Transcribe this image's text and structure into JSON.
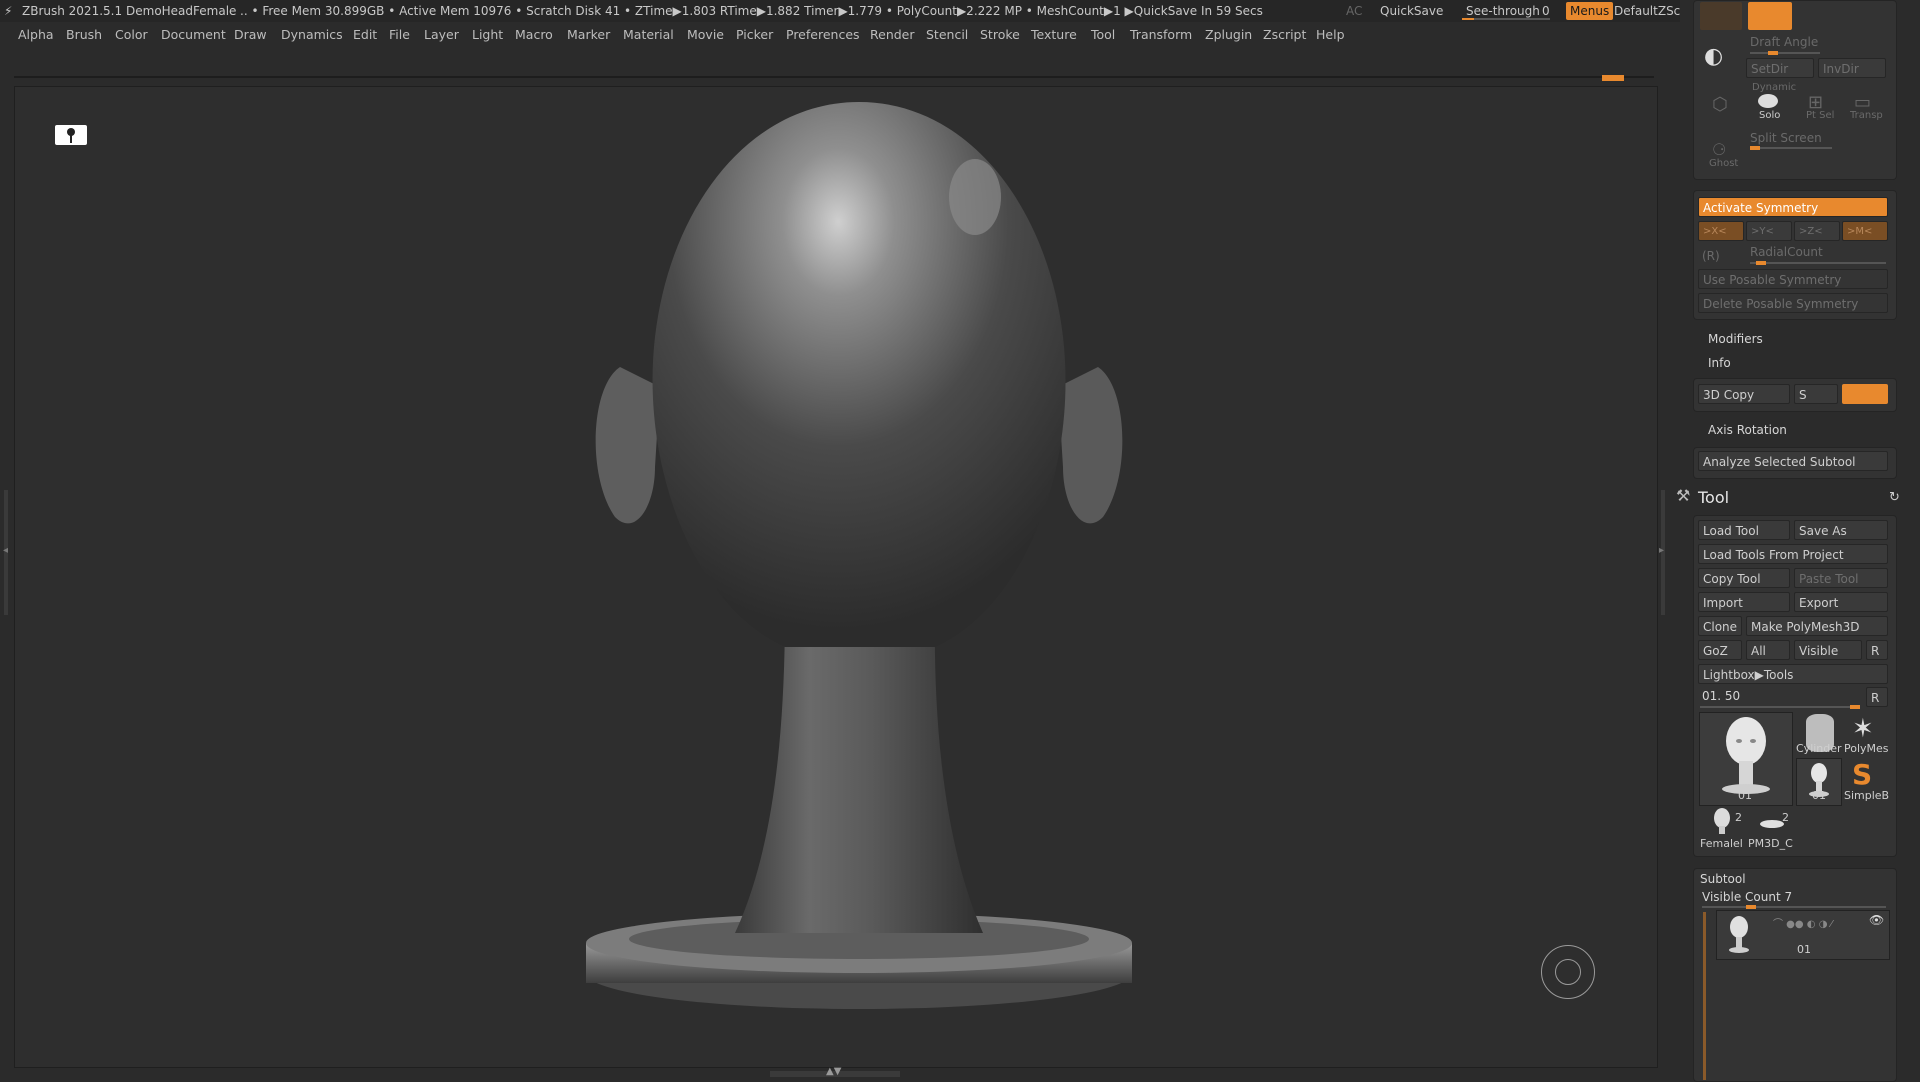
{
  "titlebar": {
    "app": "ZBrush 2021.5.1",
    "document": "DemoHeadFemale",
    "stats": ".. • Free Mem 30.899GB • Active Mem 10976 • Scratch Disk 41 •  ZTime▶1.803 RTime▶1.882 Timer▶1.779 • PolyCount▶2.222 MP  • MeshCount▶1  ▶QuickSave In 59 Secs",
    "ac": "AC",
    "quicksave": "QuickSave",
    "seethrough_label": "See-through",
    "seethrough_value": "0",
    "menus": "Menus",
    "script": "DefaultZScript"
  },
  "menubar": [
    "Alpha",
    "Brush",
    "Color",
    "Document",
    "Draw",
    "Dynamics",
    "Edit",
    "File",
    "Layer",
    "Light",
    "Macro",
    "Marker",
    "Material",
    "Movie",
    "Picker",
    "Preferences",
    "Render",
    "Stencil",
    "Stroke",
    "Texture",
    "Tool",
    "Transform",
    "Zplugin",
    "Zscript",
    "Help"
  ],
  "top_panel": {
    "draft_angle": "Draft Angle",
    "setdir": "SetDir",
    "invdir": "InvDir",
    "dynamic": "Dynamic",
    "solo": "Solo",
    "pt_sel": "Pt Sel",
    "transp": "Transp",
    "ghost": "Ghost",
    "split_screen": "Split Screen"
  },
  "symmetry": {
    "activate": "Activate Symmetry",
    "x": ">X<",
    "y": ">Y<",
    "z": ">Z<",
    "m": ">M<",
    "r": "(R)",
    "radial": "RadialCount",
    "posable": "Use Posable Symmetry",
    "delete_posable": "Delete Posable Symmetry"
  },
  "modifiers": "Modifiers",
  "info": "Info",
  "copy3d": {
    "label": "3D Copy",
    "s": "S"
  },
  "axis_rotation": "Axis Rotation",
  "analyze": "Analyze Selected Subtool",
  "tool": {
    "title": "Tool",
    "load_tool": "Load Tool",
    "save_as": "Save As",
    "load_from_project": "Load Tools From Project",
    "copy_tool": "Copy Tool",
    "paste_tool": "Paste Tool",
    "import": "Import",
    "export": "Export",
    "clone": "Clone",
    "make_polymesh": "Make PolyMesh3D",
    "goz": "GoZ",
    "all": "All",
    "visible": "Visible",
    "r": "R",
    "lightbox": "Lightbox▶Tools",
    "slider_value": "01. 50",
    "slider_r": "R",
    "thumbs": {
      "main": "01",
      "cylinder": "Cylinder",
      "polymesh": "PolyMes",
      "small01": "01",
      "simpleb": "SimpleB",
      "female": "Femalel",
      "female_count": "2",
      "pm3d": "PM3D_C",
      "pm3d_count": "2"
    }
  },
  "subtool": {
    "title": "Subtool",
    "visible_count": "Visible Count 7",
    "item_label": "01"
  },
  "colors": {
    "accent": "#e8892e",
    "bg": "#2b2b2b"
  }
}
